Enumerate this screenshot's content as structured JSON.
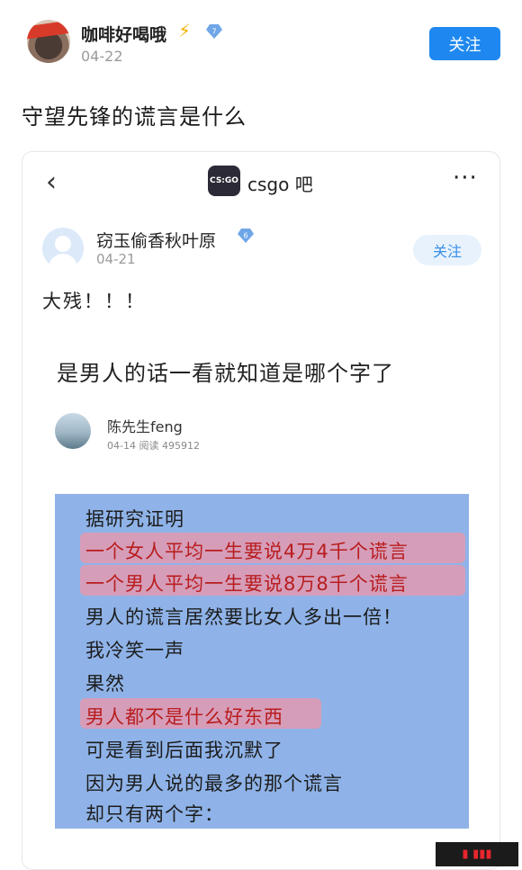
{
  "post": {
    "username": "咖啡好喝哦",
    "level": "7",
    "date": "04-22",
    "follow_label": "关注",
    "title": "守望先锋的谎言是什么"
  },
  "card": {
    "forum_logo_text": "CS:GO",
    "forum_name": "csgo 吧",
    "back_icon": "‹",
    "more_icon": "···",
    "poster": {
      "username": "窃玉偷香秋叶原",
      "level": "6",
      "date": "04-21",
      "follow_label": "关注"
    },
    "body": "大残！！！",
    "picture": {
      "title": "是男人的话一看就知道是哪个字了",
      "author": "陈先生feng",
      "author_meta": "04-14   阅读 495912",
      "lines": [
        "据研究证明",
        "一个女人平均一生要说4万4千个谎言",
        "一个男人平均一生要说8万8千个谎言",
        "男人的谎言居然要比女人多出一倍！",
        "我冷笑一声",
        "果然",
        "男人都不是什么好东西",
        "可是看到后面我沉默了",
        "因为男人说的最多的那个谎言",
        "却只有两个字："
      ]
    }
  },
  "colors": {
    "follow_blue": "#1e88f0",
    "note_blue": "#8fb3e8",
    "highlight_pink": "#ee96aa",
    "emphasis_red": "#b81d1d"
  }
}
